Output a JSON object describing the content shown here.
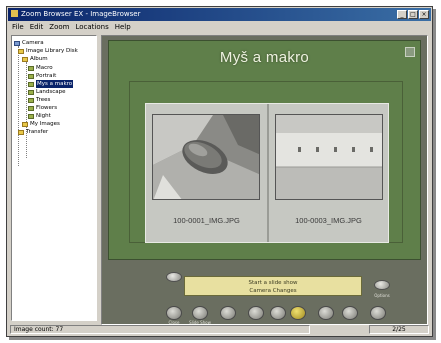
{
  "window": {
    "title": "Zoom Browser EX - ImageBrowser"
  },
  "menu": [
    "File",
    "Edit",
    "Zoom",
    "Locations",
    "Help"
  ],
  "tree": {
    "items": [
      {
        "label": "Camera",
        "icon": "cam"
      },
      {
        "label": "Image Library Disk",
        "icon": "folder"
      },
      {
        "label": "Album",
        "icon": "folder"
      },
      {
        "label": "Macro",
        "icon": "folder"
      },
      {
        "label": "Portrait",
        "icon": "folder"
      },
      {
        "label": "Mys a makro",
        "icon": "folder"
      },
      {
        "label": "Landscape",
        "icon": "folder"
      },
      {
        "label": "Trees",
        "icon": "folder"
      },
      {
        "label": "Flowers",
        "icon": "folder"
      },
      {
        "label": "Night",
        "icon": "folder"
      },
      {
        "label": "My Images",
        "icon": "folder"
      },
      {
        "label": "Transfer",
        "icon": "folder"
      }
    ]
  },
  "album": {
    "title": "Myš a makro",
    "thumbnails": [
      {
        "filename": "100-0001_IMG.JPG"
      },
      {
        "filename": "100-0003_IMG.JPG"
      }
    ]
  },
  "player": {
    "line1": "Start a slide show",
    "line2": "Camera Changes",
    "right_button_label": "Options",
    "left_button_label": "Close",
    "second_button_label": "Slide Show"
  },
  "status": {
    "left": "Image count: 77",
    "right": "2/25"
  },
  "icons": {
    "app": "camera-app-icon",
    "minimize": "minimize-icon",
    "maximize": "maximize-icon",
    "close": "close-icon"
  },
  "colors": {
    "panel": "#5f7f4a",
    "display": "#e8e0a0",
    "titlebar": "#0a246a"
  }
}
